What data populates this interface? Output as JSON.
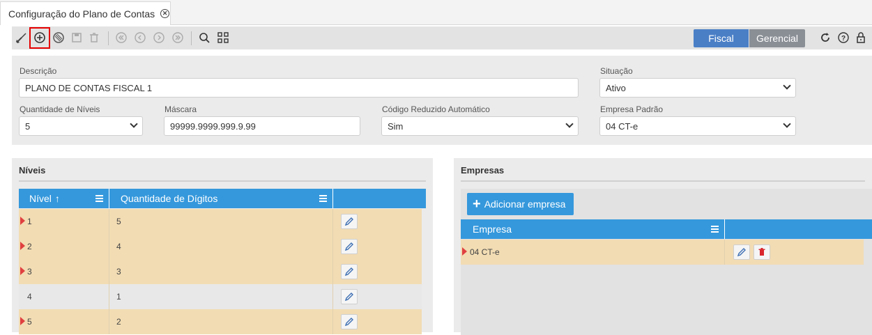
{
  "tab": {
    "title": "Configuração do Plano de Contas"
  },
  "toolbar": {
    "fiscal_label": "Fiscal",
    "gerencial_label": "Gerencial"
  },
  "form": {
    "descricao": {
      "label": "Descrição",
      "value": "PLANO DE CONTAS FISCAL 1"
    },
    "situacao": {
      "label": "Situação",
      "value": "Ativo"
    },
    "qtd_niveis": {
      "label": "Quantidade de Níveis",
      "value": "5"
    },
    "mascara": {
      "label": "Máscara",
      "value": "99999.9999.999.9.99"
    },
    "codigo_reduzido": {
      "label": "Código Reduzido Automático",
      "value": "Sim"
    },
    "empresa_padrao": {
      "label": "Empresa Padrão",
      "value": "04 CT-e"
    }
  },
  "niveis": {
    "title": "Níveis",
    "columns": [
      "Nível",
      "Quantidade de Dígitos"
    ],
    "rows": [
      {
        "nivel": "1",
        "digitos": "5"
      },
      {
        "nivel": "2",
        "digitos": "4"
      },
      {
        "nivel": "3",
        "digitos": "3"
      },
      {
        "nivel": "4",
        "digitos": "1"
      },
      {
        "nivel": "5",
        "digitos": "2"
      }
    ]
  },
  "empresas": {
    "title": "Empresas",
    "add_label": "Adicionar empresa",
    "columns": [
      "Empresa"
    ],
    "rows": [
      {
        "empresa": "04 CT-e"
      }
    ]
  },
  "colors": {
    "accent": "#3598dc",
    "row_highlight": "#f2dcb3",
    "row_plain": "#e8e8e8",
    "tab_button": "#4a7fc6"
  }
}
